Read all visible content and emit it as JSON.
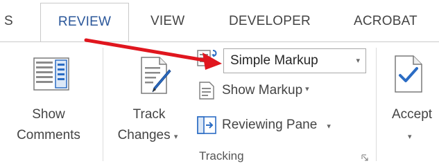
{
  "tabs": [
    {
      "label": "S",
      "active": false
    },
    {
      "label": "REVIEW",
      "active": true
    },
    {
      "label": "VIEW",
      "active": false
    },
    {
      "label": "DEVELOPER",
      "active": false
    },
    {
      "label": "ACROBAT",
      "active": false
    }
  ],
  "ribbon": {
    "show_comments": {
      "line1": "Show",
      "line2": "Comments",
      "icon": "comments-pane-icon"
    },
    "track_changes": {
      "line1": "Track",
      "line2": "Changes",
      "icon": "track-changes-icon",
      "caret": "▾"
    },
    "markup_combo": {
      "value": "Simple Markup",
      "icon": "display-for-review-icon",
      "arrow": "▾"
    },
    "show_markup": {
      "label": "Show Markup",
      "icon": "show-markup-icon",
      "caret": "▾"
    },
    "reviewing_pane": {
      "label": "Reviewing Pane",
      "icon": "reviewing-pane-icon",
      "caret": "▾"
    },
    "accept": {
      "label": "Accept",
      "icon": "accept-icon",
      "caret": "▾"
    },
    "tracking_group": {
      "label": "Tracking",
      "launcher_icon": "dialog-launcher-icon"
    }
  },
  "colors": {
    "active_tab_text": "#2b579a",
    "arrow": "#e0161e",
    "icon_blue": "#2b6cc4"
  }
}
